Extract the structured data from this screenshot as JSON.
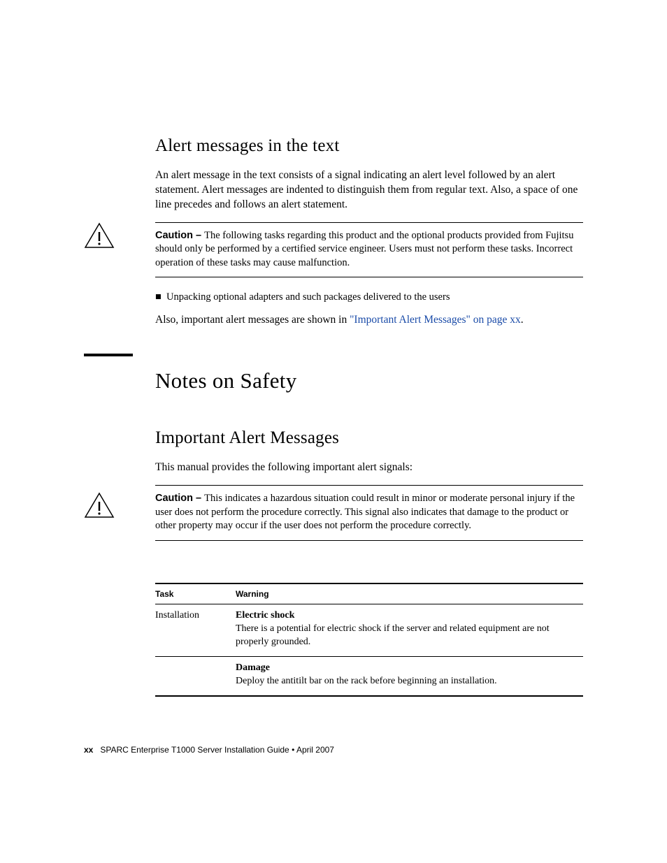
{
  "section1": {
    "heading": "Alert messages in the text",
    "intro": "An alert message in the text consists of a signal indicating an alert level followed by an alert statement. Alert messages are indented to distinguish them from regular text. Also, a space of one line precedes and follows an alert statement.",
    "caution_label": "Caution – ",
    "caution_text": "The following tasks regarding this product and the optional products provided from Fujitsu should only be performed by a certified service engineer. Users must not perform these tasks. Incorrect operation of these tasks may cause malfunction.",
    "bullet1": "Unpacking optional adapters and such packages delivered to the users",
    "also_pre": "Also, important alert messages are shown in ",
    "also_link": "\"Important Alert Messages\" on page xx",
    "also_post": "."
  },
  "section2": {
    "major_heading": "Notes on Safety",
    "sub_heading": "Important Alert Messages",
    "intro": "This manual provides the following important alert signals:",
    "caution_label": "Caution – ",
    "caution_text": "This indicates a hazardous situation could result in minor or moderate personal injury if the user does not perform the procedure correctly. This signal also indicates that damage to the product or other property may occur if the user does not perform the procedure correctly."
  },
  "table": {
    "col1": "Task",
    "col2": "Warning",
    "rows": [
      {
        "task": "Installation",
        "warn_title": "Electric shock",
        "warn_text": "There is a potential for electric shock if the server and related equipment are not properly grounded."
      },
      {
        "task": "",
        "warn_title": "Damage",
        "warn_text": "Deploy the antitilt bar on the rack before beginning an installation."
      }
    ]
  },
  "footer": {
    "page": "xx",
    "title": "SPARC Enterprise T1000 Server Installation Guide  •  April 2007"
  }
}
